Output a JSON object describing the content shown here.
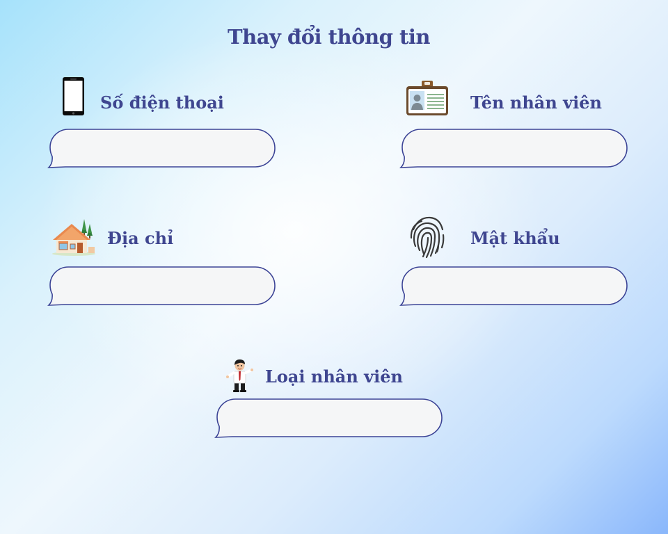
{
  "page": {
    "title": "Thay đổi thông tin"
  },
  "fields": {
    "phone": {
      "label": "Số điện thoại",
      "value": "",
      "icon": "smartphone-icon"
    },
    "employee_name": {
      "label": "Tên nhân viên",
      "value": "",
      "icon": "id-badge-icon"
    },
    "address": {
      "label": "Địa chỉ",
      "value": "",
      "icon": "house-icon"
    },
    "password": {
      "label": "Mật khẩu",
      "value": "",
      "icon": "fingerprint-icon"
    },
    "employee_type": {
      "label": "Loại nhân viên",
      "value": "",
      "icon": "businessman-icon"
    }
  },
  "colors": {
    "text": "#3f4690",
    "bubble_border": "#3c4496",
    "bubble_fill": "#f5f6f7"
  }
}
